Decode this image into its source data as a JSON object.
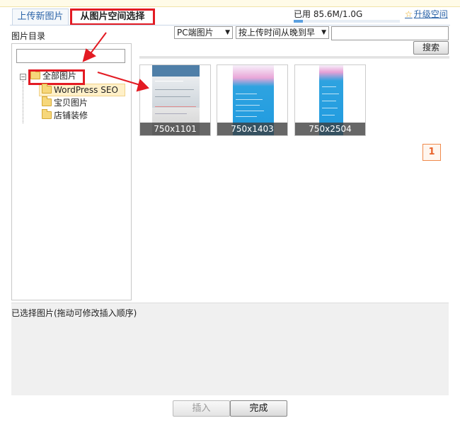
{
  "tabs": [
    {
      "label": "上传新图片",
      "active": false
    },
    {
      "label": "从图片空间选择",
      "active": true
    }
  ],
  "usage": {
    "label": "已用 85.6M/1.0G",
    "fraction": 0.0856
  },
  "upgrade_label": "升级空间",
  "directory": {
    "title": "图片目录",
    "search_value": "",
    "tree": [
      {
        "label": "全部图片",
        "level": 0,
        "expanded": true
      },
      {
        "label": "WordPress SEO",
        "level": 1,
        "selected": true
      },
      {
        "label": "宝贝图片",
        "level": 1
      },
      {
        "label": "店铺装修",
        "level": 1
      }
    ]
  },
  "filters": {
    "source_select": "PC端图片",
    "sort_select": "按上传时间从晚到早",
    "search_value": "",
    "search_button": "搜索"
  },
  "images": [
    {
      "size_label": "750x1101"
    },
    {
      "size_label": "750x1403"
    },
    {
      "size_label": "750x2504"
    }
  ],
  "pagination": {
    "current": "1"
  },
  "selected_area": {
    "title": "已选择图片(拖动可修改插入顺序)"
  },
  "buttons": {
    "insert": "插入",
    "done": "完成"
  },
  "colors": {
    "highlight_red": "#e31b23",
    "link_blue": "#2c64a8",
    "page_orange": "#e8622a"
  }
}
